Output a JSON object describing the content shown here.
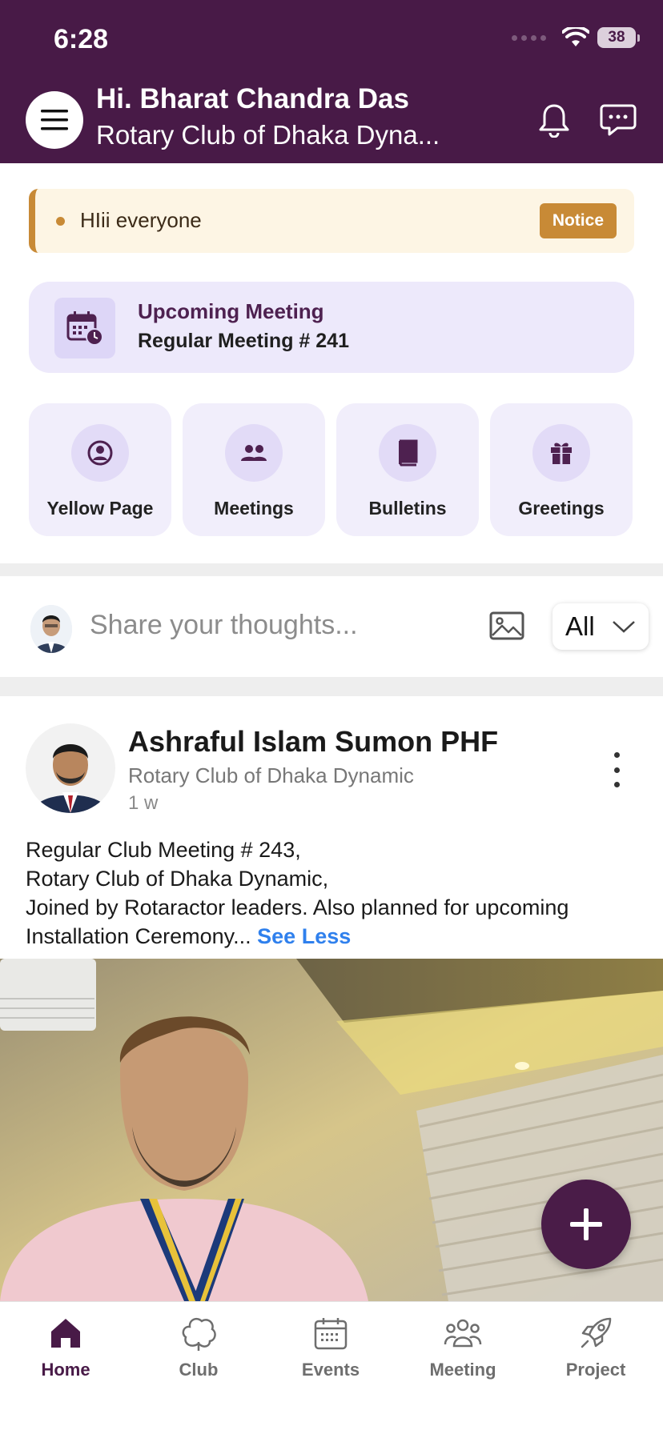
{
  "status_bar": {
    "time": "6:28",
    "battery": "38"
  },
  "header": {
    "greeting": "Hi. Bharat Chandra Das",
    "club": "Rotary Club of Dhaka Dyna..."
  },
  "notice": {
    "text": "HIii everyone",
    "badge": "Notice",
    "accent_color": "#c88a36"
  },
  "upcoming_meeting": {
    "label": "Upcoming Meeting",
    "title": "Regular Meeting # 241"
  },
  "quick_actions": [
    {
      "label": "Yellow Page",
      "icon": "person-circle-icon"
    },
    {
      "label": "Meetings",
      "icon": "people-icon"
    },
    {
      "label": "Bulletins",
      "icon": "book-icon"
    },
    {
      "label": "Greetings",
      "icon": "gift-icon"
    }
  ],
  "composer": {
    "placeholder": "Share your thoughts...",
    "filter": "All"
  },
  "post": {
    "author": "Ashraful Islam Sumon PHF",
    "club": "Rotary Club of Dhaka Dynamic",
    "time": "1 w",
    "lines": [
      "Regular Club Meeting # 243,",
      "Rotary Club of Dhaka Dynamic,",
      "Joined by Rotaractor leaders. Also planned for upcoming",
      "Installation Ceremony..."
    ],
    "see_less": "See Less"
  },
  "bottom_nav": [
    {
      "label": "Home",
      "icon": "home-icon",
      "active": true
    },
    {
      "label": "Club",
      "icon": "club-icon",
      "active": false
    },
    {
      "label": "Events",
      "icon": "calendar-icon",
      "active": false
    },
    {
      "label": "Meeting",
      "icon": "group-icon",
      "active": false
    },
    {
      "label": "Project",
      "icon": "rocket-icon",
      "active": false
    }
  ],
  "colors": {
    "primary": "#481a47",
    "card": "#ede9fb",
    "link": "#2f80ed"
  }
}
